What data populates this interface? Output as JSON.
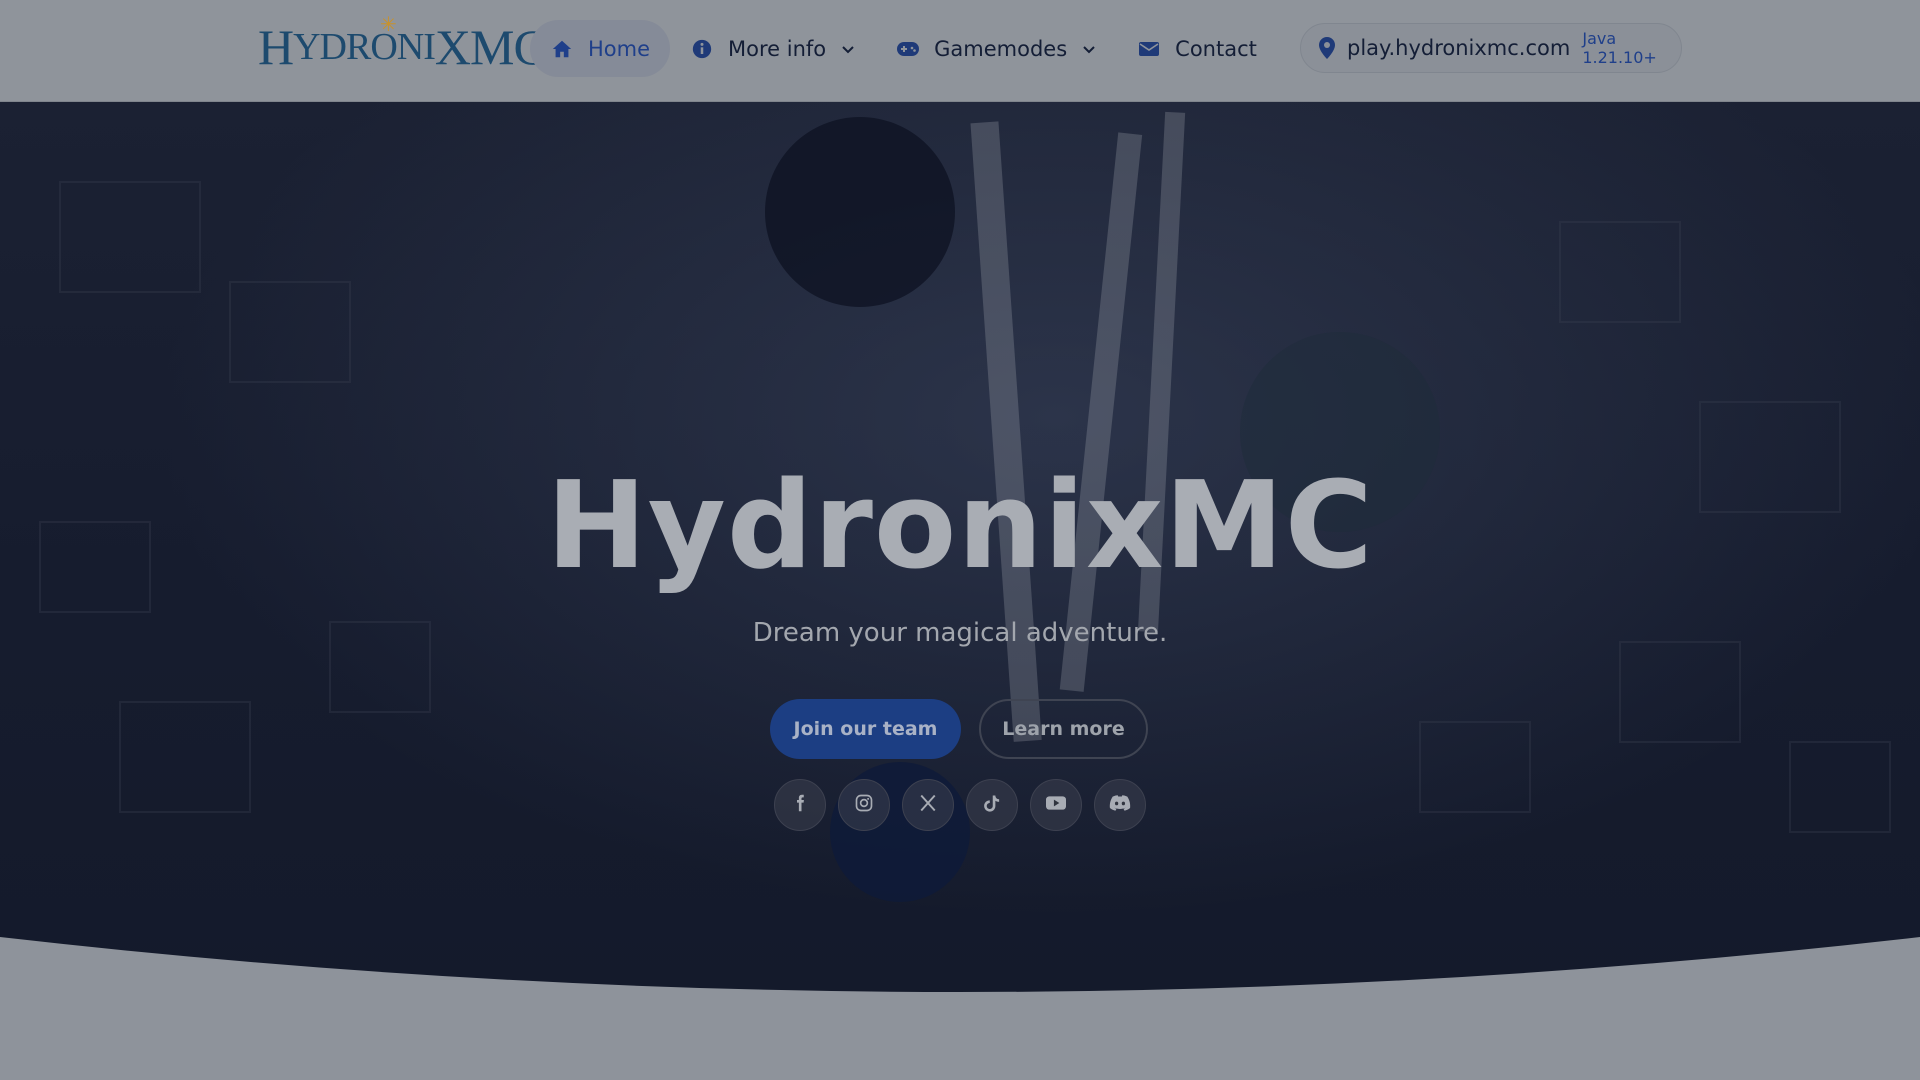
{
  "logo": {
    "text_big_1": "H",
    "text_small_1": "YDRONI",
    "text_big_2": "X",
    "text_big_3": "MC",
    "full": "HydronixMC"
  },
  "nav": {
    "items": [
      {
        "label": "Home",
        "icon": "home-icon"
      },
      {
        "label": "More info",
        "icon": "info-icon",
        "dropdown": true
      },
      {
        "label": "Gamemodes",
        "icon": "gamepad-icon",
        "dropdown": true
      },
      {
        "label": "Contact",
        "icon": "envelope-icon"
      }
    ],
    "server": {
      "address": "play.hydronixmc.com",
      "version": "Java 1.21.10+",
      "icon": "map-pin-icon"
    }
  },
  "hero": {
    "title": "HydronixMC",
    "subtitle": "Dream your magical adventure.",
    "primary_button": "Join our team",
    "secondary_button": "Learn more",
    "socials": [
      "facebook-icon",
      "instagram-icon",
      "x-icon",
      "tiktok-icon",
      "youtube-icon",
      "discord-icon"
    ]
  },
  "colors": {
    "accent": "#1c3e83",
    "nav_active": "#1f3f8a",
    "text_dark": "#141e36"
  }
}
